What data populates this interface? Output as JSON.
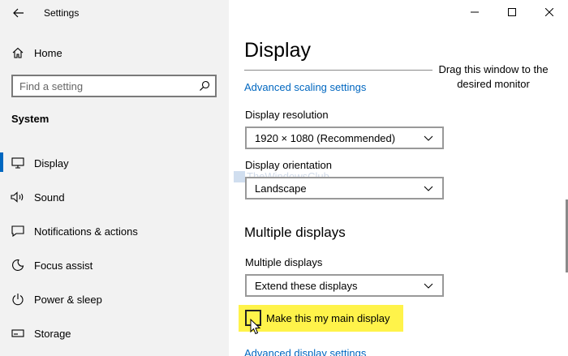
{
  "app": {
    "title": "Settings"
  },
  "sidebar": {
    "home_label": "Home",
    "search_placeholder": "Find a setting",
    "section": "System",
    "items": [
      {
        "label": "Display",
        "icon": "monitor-icon",
        "active": true
      },
      {
        "label": "Sound",
        "icon": "speaker-icon",
        "active": false
      },
      {
        "label": "Notifications & actions",
        "icon": "notification-icon",
        "active": false
      },
      {
        "label": "Focus assist",
        "icon": "moon-icon",
        "active": false
      },
      {
        "label": "Power & sleep",
        "icon": "power-icon",
        "active": false
      },
      {
        "label": "Storage",
        "icon": "storage-icon",
        "active": false
      }
    ]
  },
  "main": {
    "title": "Display",
    "advanced_scaling_link": "Advanced scaling settings",
    "resolution": {
      "label": "Display resolution",
      "value": "1920 × 1080 (Recommended)"
    },
    "orientation": {
      "label": "Display orientation",
      "value": "Landscape"
    },
    "multiple_heading": "Multiple displays",
    "multiple": {
      "label": "Multiple displays",
      "value": "Extend these displays"
    },
    "main_display_checkbox": {
      "label": "Make this my main display",
      "checked": false
    },
    "advanced_display_link": "Advanced display settings",
    "drag_hint": "Drag this window to the desired monitor",
    "watermark": "TheWindowsClub"
  },
  "colors": {
    "accent": "#0067c0",
    "highlight": "#fff34a",
    "sidebar_bg": "#f2f2f2"
  }
}
